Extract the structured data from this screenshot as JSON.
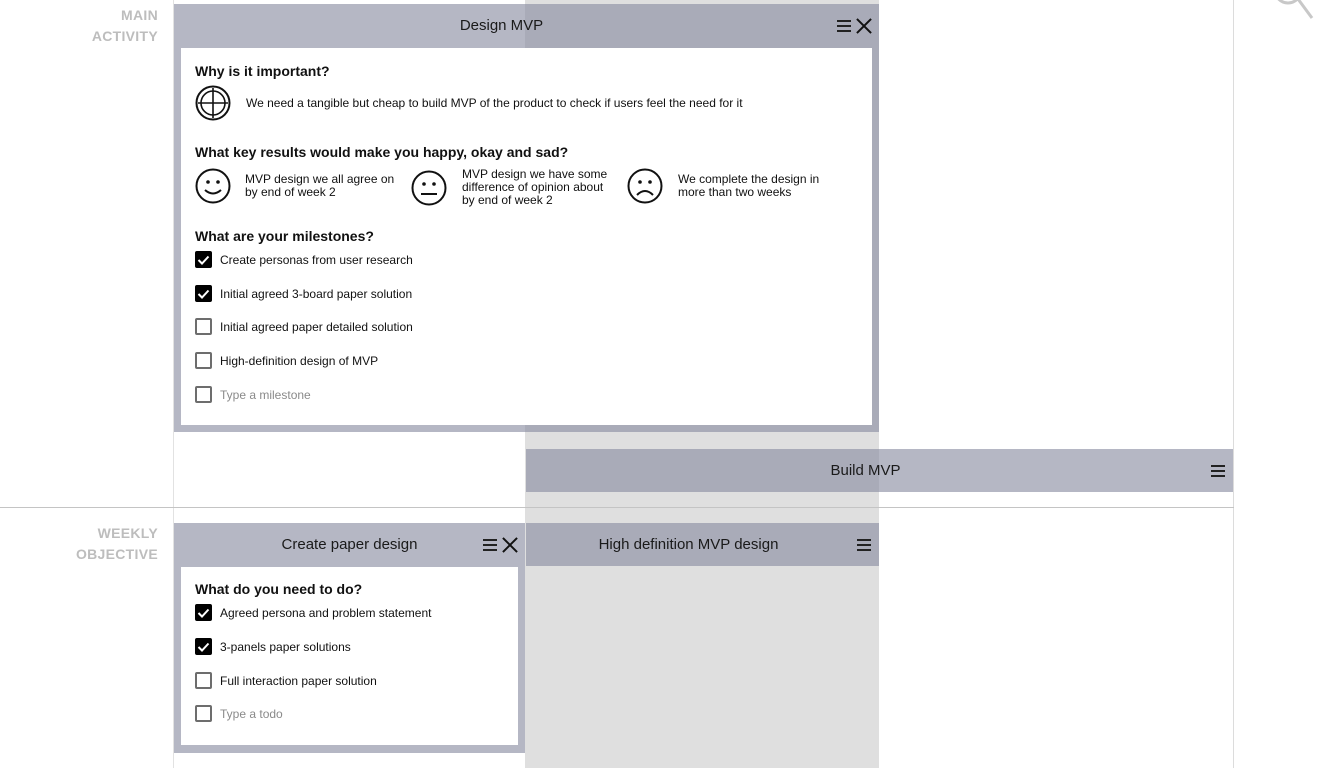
{
  "rows": {
    "main_activity": [
      "MAIN",
      "ACTIVITY"
    ],
    "weekly_objective": [
      "WEEKLY",
      "OBJECTIVE"
    ]
  },
  "icons": {
    "search": "search-icon",
    "menu": "hamburger-menu-icon",
    "close": "close-icon",
    "target": "crosshair-target-icon",
    "happy": "happy-face-icon",
    "neutral": "neutral-face-icon",
    "sad": "sad-face-icon",
    "checkmark": "checkmark-icon"
  },
  "colors": {
    "card_frame": "#b5b7c4",
    "card_header_dark": "#a9abb8",
    "week_column": "#dfdfdf",
    "row_label": "#bdbdbd"
  },
  "design_mvp": {
    "title": "Design MVP",
    "why_title": "Why is it important?",
    "why_text": "We need a tangible but cheap to build MVP of the product to check if users feel the need for it",
    "key_results_title": "What key results would make you happy, okay and sad?",
    "key_results": {
      "happy": "MVP design we all agree on by end of week 2",
      "okay": "MVP design we have some difference of opinion about by end of week 2",
      "sad": "We complete the design in more than two weeks"
    },
    "milestones_title": "What are your milestones?",
    "milestones": [
      {
        "label": "Create personas from user research",
        "checked": true
      },
      {
        "label": "Initial agreed 3-board paper solution",
        "checked": true
      },
      {
        "label": "Initial agreed paper detailed solution",
        "checked": false
      },
      {
        "label": "High-definition design of MVP",
        "checked": false
      }
    ],
    "new_milestone_placeholder": "Type a milestone"
  },
  "build_mvp": {
    "title": "Build MVP"
  },
  "create_paper_design": {
    "title": "Create paper design",
    "todo_title": "What do you need to do?",
    "todos": [
      {
        "label": "Agreed persona and problem statement",
        "checked": true
      },
      {
        "label": "3-panels paper solutions",
        "checked": true
      },
      {
        "label": "Full interaction paper solution",
        "checked": false
      }
    ],
    "new_todo_placeholder": "Type a todo"
  },
  "high_def_design": {
    "title": "High definition MVP design"
  }
}
